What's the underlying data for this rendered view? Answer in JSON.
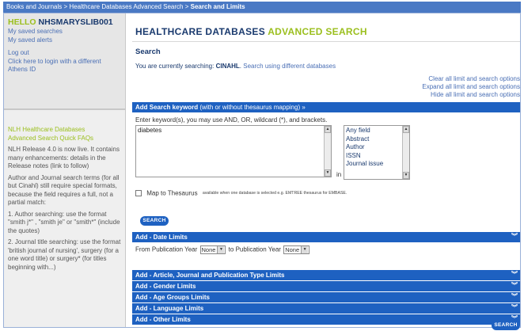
{
  "breadcrumb": {
    "item1": "Books and Journals",
    "sep": ">",
    "item2": "Healthcare Databases Advanced Search",
    "item3": "Search and Limits"
  },
  "sidebar": {
    "hello": "HELLO",
    "username": "NHSMARYSLIB001",
    "saved_searches": "My saved searches",
    "saved_alerts": "My saved alerts",
    "logout": "Log out",
    "athens_line1": "Click here to login with a different",
    "athens_line2": "Athens ID",
    "faq_line1": "NLH Healthcare Databases",
    "faq_line2": "Advanced Search Quick FAQs",
    "para1": "NLH Release 4.0 is now live. It contains many enhancements: details in the Release notes (link to follow)",
    "para2": "Author and Journal search terms (for all but Cinahl) still require special formats, because the field requires a full, not a partial match:",
    "para3": "1. Author searching: use the format \"smith j*\" , \"smith je\" or \"smith*\" (include the quotes)",
    "para4": "2. Journal title searching: use the format 'british journal of nursing', surgery (for a one word title) or surgery* (for titles beginning with...)"
  },
  "main": {
    "title_part1": "HEALTHCARE DATABASES",
    "title_part2": "ADVANCED SEARCH",
    "search_heading": "Search",
    "currently_searching": "You are currently searching:",
    "database": "CINAHL",
    "change_db": "Search using different databases",
    "clear_limits": "Clear all limit and search options",
    "expand_limits": "Expand all limit and search options",
    "hide_limits": "Hide all limit and search options",
    "keyword_bar_bold": "Add Search keyword",
    "keyword_bar_rest": "(with or without thesaurus mapping) »",
    "keyword_hint": "Enter keyword(s), you may use AND, OR, wildcard (*), and brackets.",
    "keyword_value": "diabetes",
    "in_label": "in",
    "field_options": [
      "Any field",
      "Abstract",
      "Author",
      "ISSN",
      "Journal issue"
    ],
    "map_label": "Map to Thesaurus",
    "map_note": "available when one database is selected e.g. EMTREE thesaurus for EMBASE.",
    "search_button": "SEARCH",
    "date_bar": "Add - Date Limits",
    "from_label": "From Publication Year",
    "from_value": "None",
    "to_label": "to Publication Year",
    "to_value": "None",
    "limit_bars": [
      "Add - Article, Journal and Publication Type Limits",
      "Add - Gender Limits",
      "Add - Age Groups Limits",
      "Add - Language Limits",
      "Add - Other Limits"
    ],
    "search_button_bottom": "SEARCH"
  },
  "colors": {
    "accent_green": "#9bbf1e",
    "bar_blue": "#1e61c1",
    "navy": "#1a3a6e",
    "link_blue": "#4a6fb5"
  }
}
